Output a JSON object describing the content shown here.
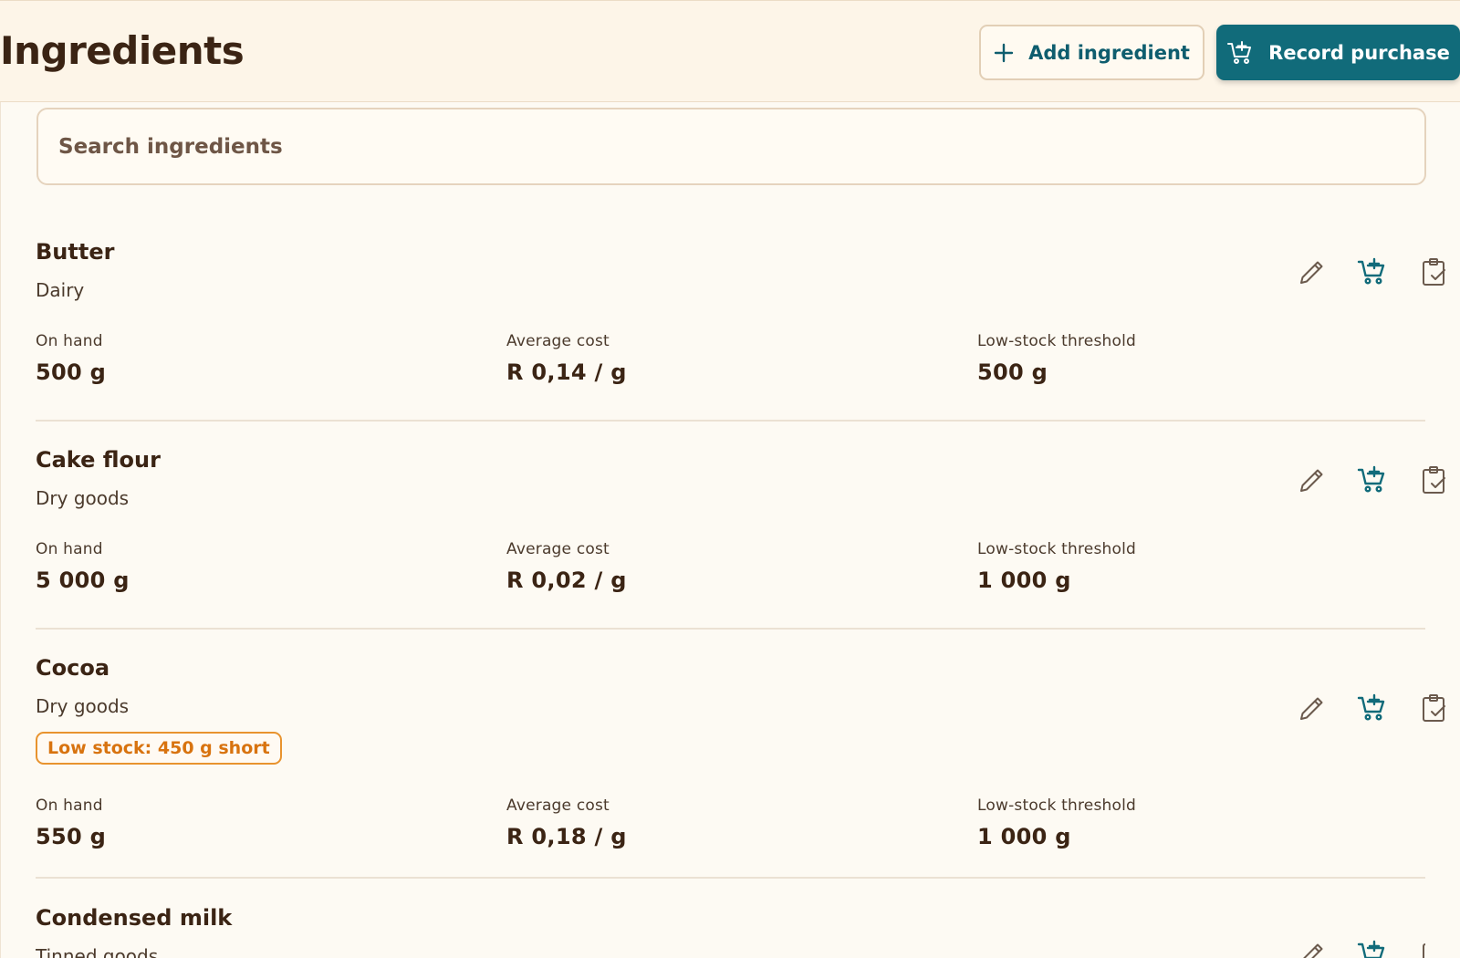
{
  "header": {
    "title": "Ingredients",
    "add_label": "Add ingredient",
    "record_label": "Record purchase"
  },
  "search": {
    "placeholder": "Search ingredients"
  },
  "labels": {
    "on_hand": "On hand",
    "avg_cost": "Average cost",
    "threshold": "Low-stock threshold"
  },
  "ingredients": [
    {
      "name": "Butter",
      "category": "Dairy",
      "on_hand": "500 g",
      "avg_cost": "R 0,14 / g",
      "threshold": "500 g"
    },
    {
      "name": "Cake flour",
      "category": "Dry goods",
      "on_hand": "5 000 g",
      "avg_cost": "R 0,02 / g",
      "threshold": "1 000 g"
    },
    {
      "name": "Cocoa",
      "category": "Dry goods",
      "badge": "Low stock: 450 g short",
      "on_hand": "550 g",
      "avg_cost": "R 0,18 / g",
      "threshold": "1 000 g"
    },
    {
      "name": "Condensed milk",
      "category": "Tinned goods"
    }
  ],
  "icons": {
    "edit": "pencil-icon",
    "purchase": "cart-plus-icon",
    "stocktake": "clipboard-check-icon",
    "archive": "archive-icon",
    "delete": "trash-icon"
  },
  "colors": {
    "accent": "#116b7a",
    "danger": "#c0392b",
    "warning": "#d8730f",
    "icon_muted": "#6b5a4d"
  }
}
